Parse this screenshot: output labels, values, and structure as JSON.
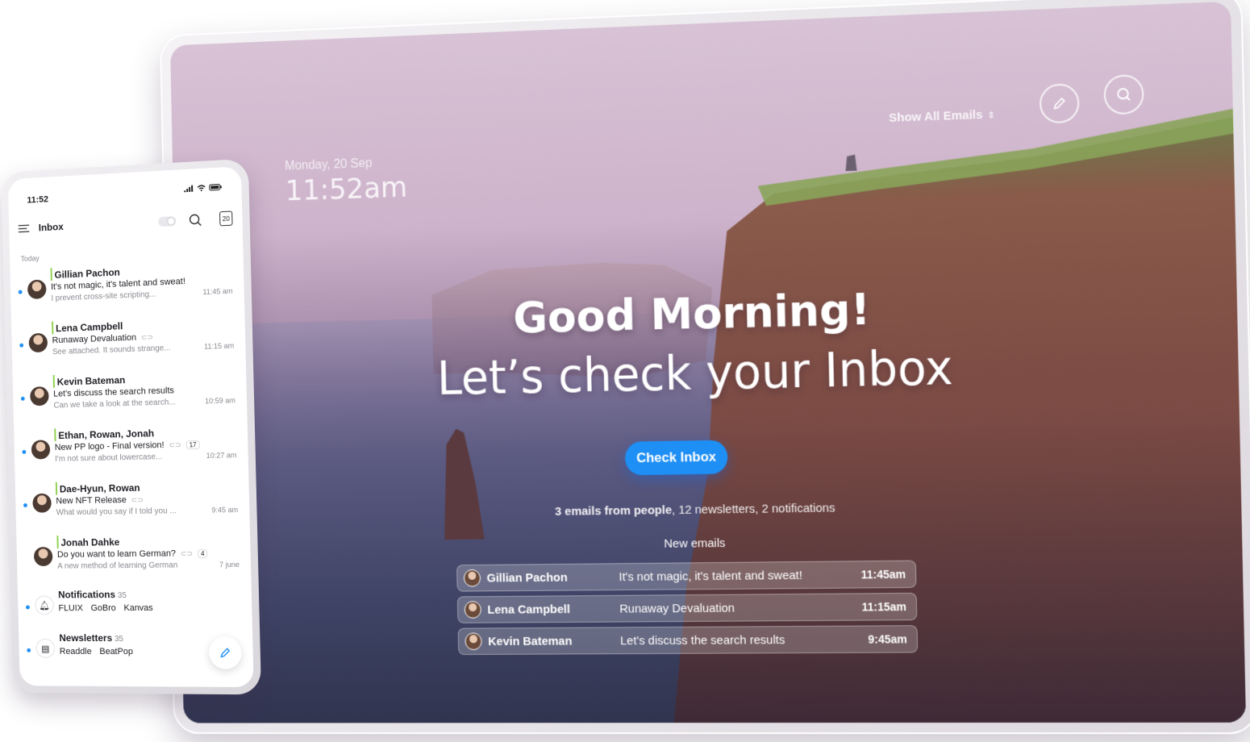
{
  "tablet": {
    "date": "Monday, 20 Sep",
    "time": "11:52am",
    "filter_label": "Show All Emails",
    "greeting_line1": "Good Morning!",
    "greeting_line2": "Let’s check your Inbox",
    "cta_label": "Check Inbox",
    "summary_bold": "3 emails from people",
    "summary_rest": ", 12 newsletters, 2 notifications",
    "new_emails_label": "New emails",
    "emails": [
      {
        "name": "Gillian Pachon",
        "subject": "It's not magic, it's talent and sweat!",
        "time": "11:45am"
      },
      {
        "name": "Lena Campbell",
        "subject": "Runaway Devaluation",
        "time": "11:15am"
      },
      {
        "name": "Kevin Bateman",
        "subject": "Let’s discuss the search results",
        "time": "9:45am"
      }
    ],
    "accent_color": "#1e8ff5"
  },
  "phone": {
    "status_time": "11:52",
    "title": "Inbox",
    "calendar_day": "20",
    "section_label": "Today",
    "messages": [
      {
        "sender": "Gillian Pachon",
        "subject": "It's not magic, it's talent and sweat!",
        "preview": "I prevent cross-site scripting...",
        "time": "11:45 am",
        "count": ""
      },
      {
        "sender": "Lena Campbell",
        "subject": "Runaway Devaluation",
        "preview": "See attached. It sounds strange...",
        "time": "11:15 am",
        "count": ""
      },
      {
        "sender": "Kevin Bateman",
        "subject": "Let’s discuss the search results",
        "preview": "Can we take a look at the search...",
        "time": "10:59 am",
        "count": ""
      },
      {
        "sender": "Ethan, Rowan, Jonah",
        "subject": "New PP logo - Final version!",
        "preview": "I'm not sure about lowercase...",
        "time": "10:27 am",
        "count": "17"
      },
      {
        "sender": "Dae-Hyun, Rowan",
        "subject": "New NFT Release",
        "preview": "What would you say if I told you ...",
        "time": "9:45 am",
        "count": ""
      },
      {
        "sender": "Jonah Dahke",
        "subject": "Do you want to learn German?",
        "preview": "A new method of learning German",
        "time": "7 june",
        "count": "4"
      }
    ],
    "notifications": {
      "title": "Notifications",
      "count": "35",
      "apps": [
        "FLUIX",
        "GoBro",
        "Kanvas"
      ]
    },
    "newsletters": {
      "title": "Newsletters",
      "count": "35",
      "apps": [
        "Readdle",
        "BeatPop"
      ]
    }
  }
}
